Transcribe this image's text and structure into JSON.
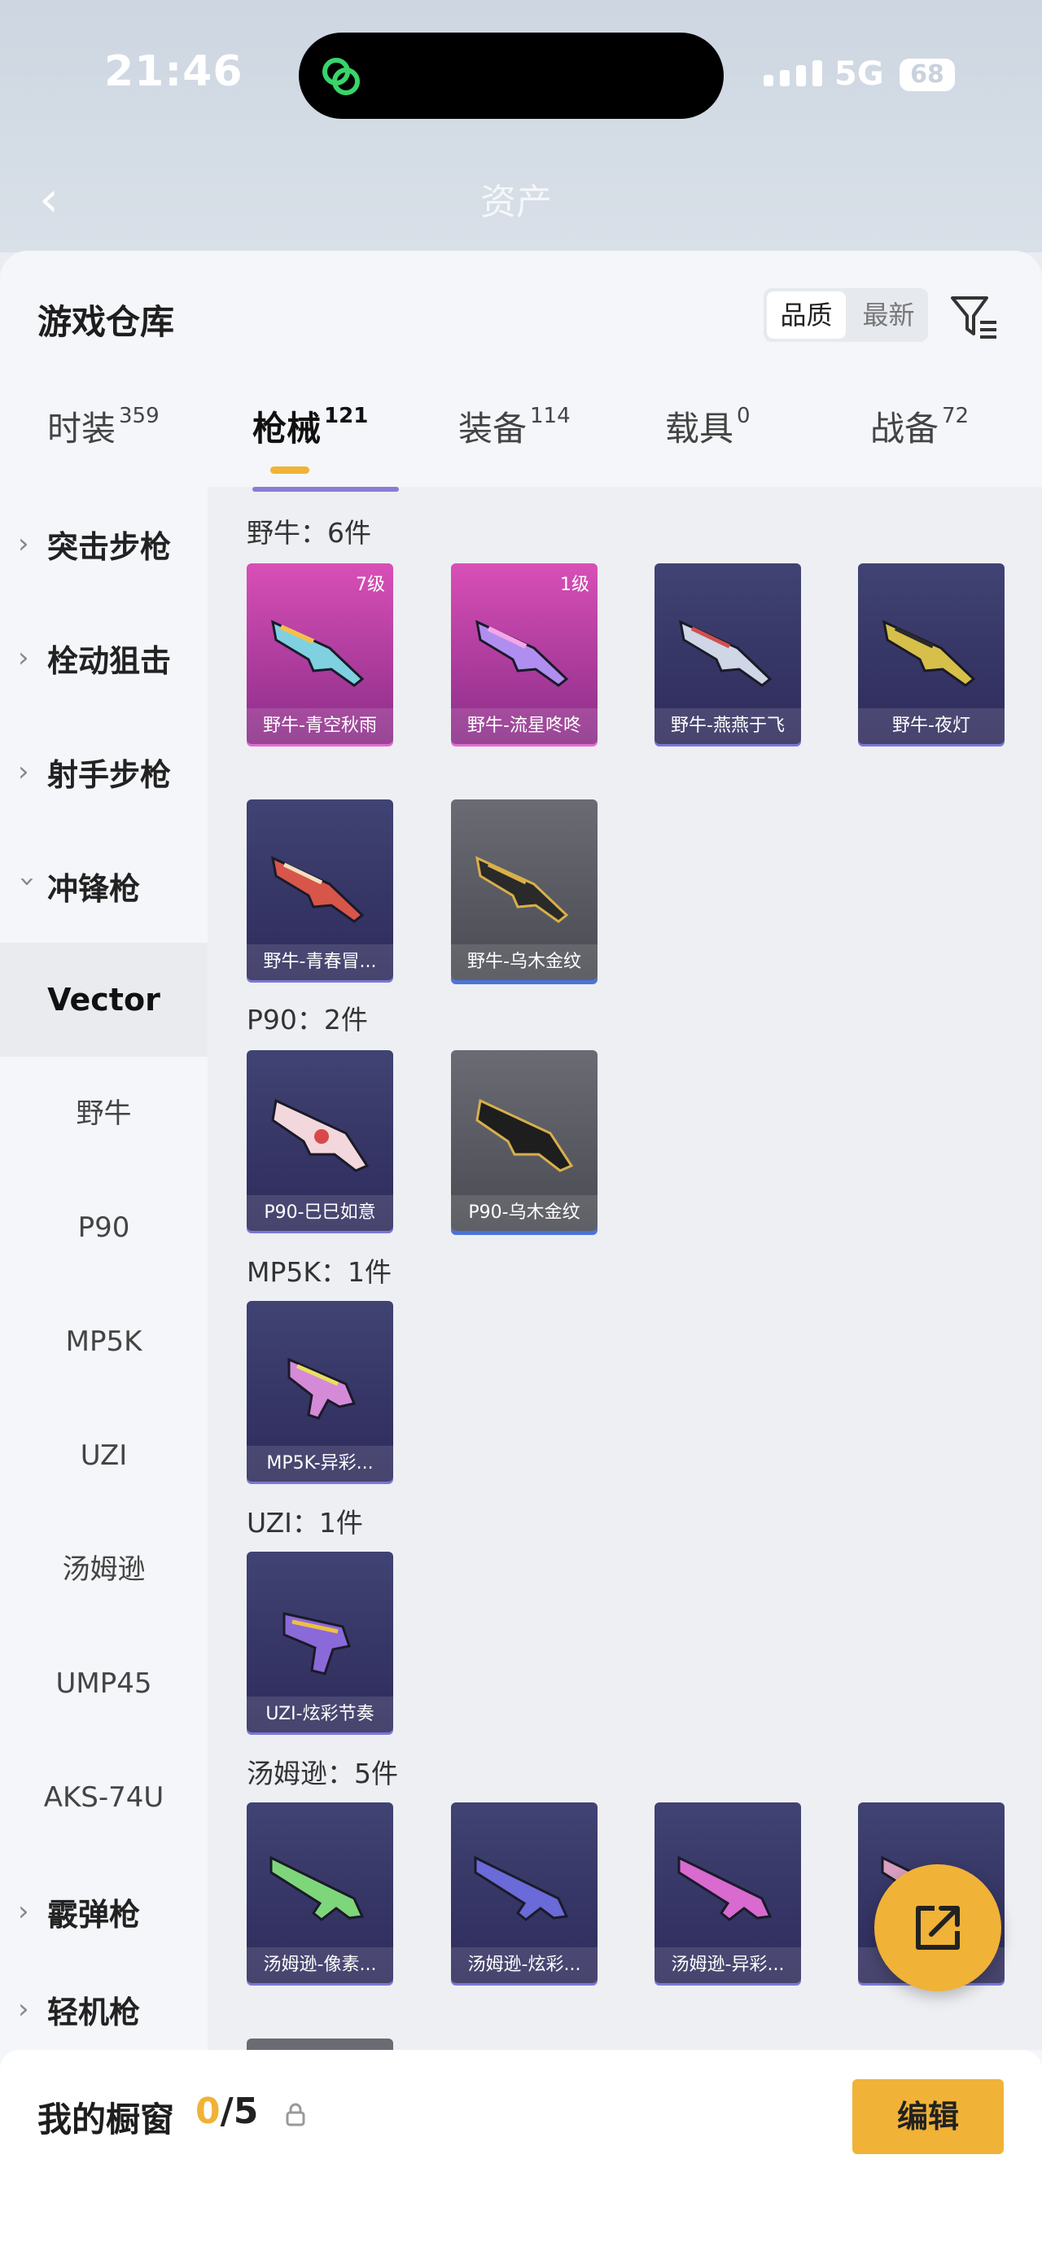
{
  "status_bar": {
    "time": "21:46",
    "network": "5G",
    "battery": "68"
  },
  "nav": {
    "back_icon": "chevron-left-icon",
    "title": "资产"
  },
  "header": {
    "title": "游戏仓库",
    "sort_options": [
      "品质",
      "最新"
    ],
    "filter_icon": "filter-icon"
  },
  "tabs": [
    {
      "label": "时装",
      "count": "359"
    },
    {
      "label": "枪械",
      "count": "121"
    },
    {
      "label": "装备",
      "count": "114"
    },
    {
      "label": "载具",
      "count": "0"
    },
    {
      "label": "战备",
      "count": "72"
    }
  ],
  "sidebar": {
    "categories": [
      "突击步枪",
      "栓动狙击",
      "射手步枪",
      "冲锋枪"
    ],
    "selected_sub": "Vector",
    "subs": [
      "野牛",
      "P90",
      "MP5K",
      "UZI",
      "汤姆逊",
      "UMP45",
      "AKS-74U"
    ],
    "bottom_categories": [
      "霰弹枪",
      "轻机枪"
    ]
  },
  "groups": [
    {
      "title": "野牛：6件"
    },
    {
      "title": "P90：2件"
    },
    {
      "title": "MP5K：1件"
    },
    {
      "title": "UZI：1件"
    },
    {
      "title": "汤姆逊：5件"
    }
  ],
  "cards": {
    "bison": [
      {
        "name": "野牛-青空秋雨",
        "level": "7级"
      },
      {
        "name": "野牛-流星咚咚",
        "level": "1级"
      },
      {
        "name": "野牛-燕燕于飞"
      },
      {
        "name": "野牛-夜灯"
      },
      {
        "name": "野牛-青春冒..."
      },
      {
        "name": "野牛-乌木金纹"
      }
    ],
    "p90": [
      {
        "name": "P90-巳巳如意"
      },
      {
        "name": "P90-乌木金纹"
      }
    ],
    "mp5k": [
      {
        "name": "MP5K-异彩..."
      }
    ],
    "uzi": [
      {
        "name": "UZI-炫彩节奏"
      }
    ],
    "thompson": [
      {
        "name": "汤姆逊-像素..."
      },
      {
        "name": "汤姆逊-炫彩..."
      },
      {
        "name": "汤姆逊-异彩..."
      },
      {
        "name": "汤"
      }
    ]
  },
  "bottom": {
    "label": "我的橱窗",
    "count_current": "0",
    "count_total": "/5",
    "edit_label": "编辑"
  },
  "colors": {
    "accent": "#f0b237",
    "pink_card": "#c245a6",
    "purple_card": "#3a3a6a",
    "gray_card": "#5c5d64"
  }
}
